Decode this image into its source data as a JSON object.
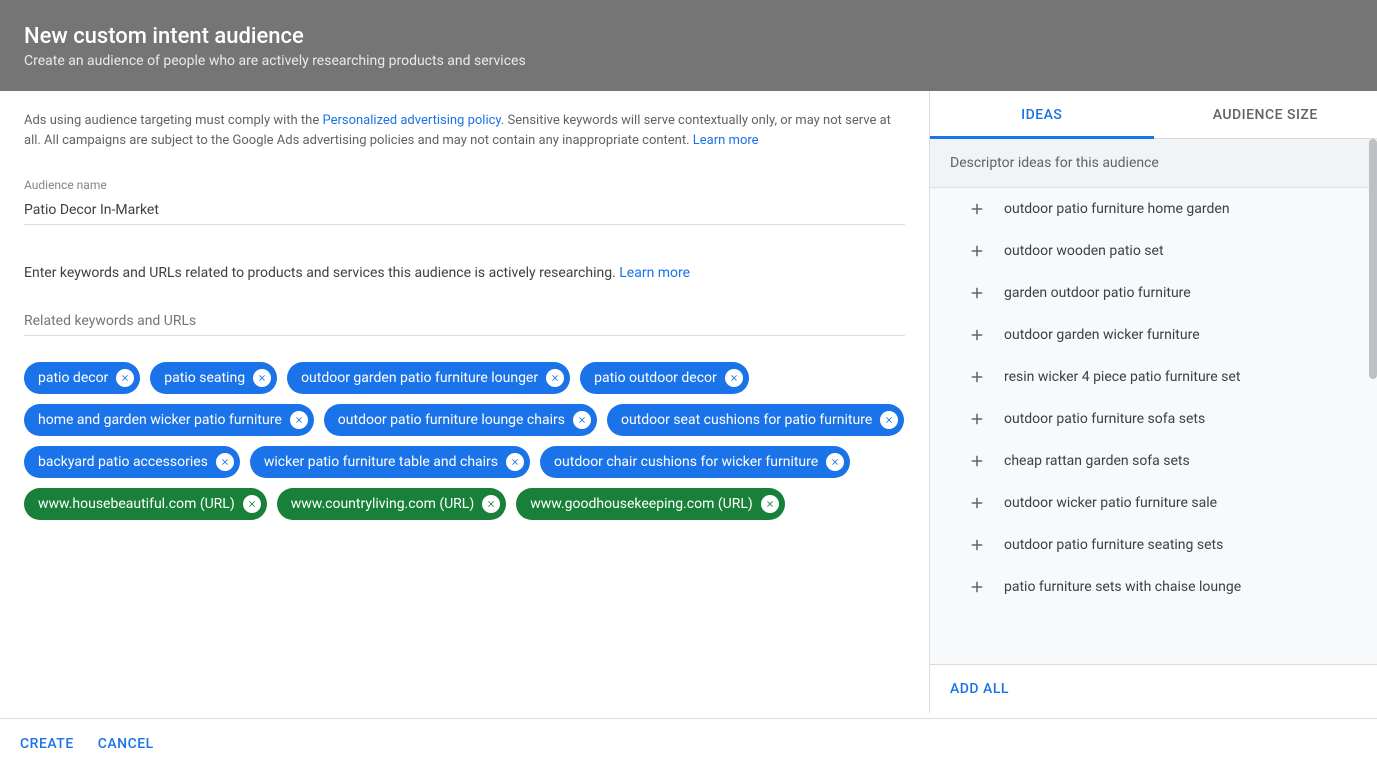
{
  "header": {
    "title": "New custom intent audience",
    "subtitle": "Create an audience of people who are actively researching products and services"
  },
  "policy": {
    "part1": "Ads using audience targeting must comply with the ",
    "link1": "Personalized advertising policy",
    "part2": ". Sensitive keywords will serve contextually only, or may not serve at all. All campaigns are subject to the Google Ads advertising policies and may not contain any inappropriate content. ",
    "link2": "Learn more"
  },
  "audience_name": {
    "label": "Audience name",
    "value": "Patio Decor In-Market"
  },
  "instructions": {
    "text": "Enter keywords and URLs related to products and services this audience is actively researching. ",
    "link": "Learn more"
  },
  "related_input": {
    "placeholder": "Related keywords and URLs"
  },
  "chips": [
    {
      "label": "patio decor",
      "type": "kw"
    },
    {
      "label": "patio seating",
      "type": "kw"
    },
    {
      "label": "outdoor garden patio furniture lounger",
      "type": "kw"
    },
    {
      "label": "patio outdoor decor",
      "type": "kw"
    },
    {
      "label": "home and garden wicker patio furniture",
      "type": "kw"
    },
    {
      "label": "outdoor patio furniture lounge chairs",
      "type": "kw"
    },
    {
      "label": "outdoor seat cushions for patio furniture",
      "type": "kw"
    },
    {
      "label": "backyard patio accessories",
      "type": "kw"
    },
    {
      "label": "wicker patio furniture table and chairs",
      "type": "kw"
    },
    {
      "label": "outdoor chair cushions for wicker furniture",
      "type": "kw"
    },
    {
      "label": "www.housebeautiful.com (URL)",
      "type": "url"
    },
    {
      "label": "www.countryliving.com (URL)",
      "type": "url"
    },
    {
      "label": "www.goodhousekeeping.com (URL)",
      "type": "url"
    }
  ],
  "sidebar": {
    "tabs": {
      "ideas": "IDEAS",
      "audience_size": "AUDIENCE SIZE"
    },
    "ideas_header": "Descriptor ideas for this audience",
    "ideas": [
      "outdoor patio furniture home garden",
      "outdoor wooden patio set",
      "garden outdoor patio furniture",
      "outdoor garden wicker furniture",
      "resin wicker 4 piece patio furniture set",
      "outdoor patio furniture sofa sets",
      "cheap rattan garden sofa sets",
      "outdoor wicker patio furniture sale",
      "outdoor patio furniture seating sets",
      "patio furniture sets with chaise lounge"
    ],
    "add_all": "ADD ALL"
  },
  "footer": {
    "create": "CREATE",
    "cancel": "CANCEL"
  }
}
